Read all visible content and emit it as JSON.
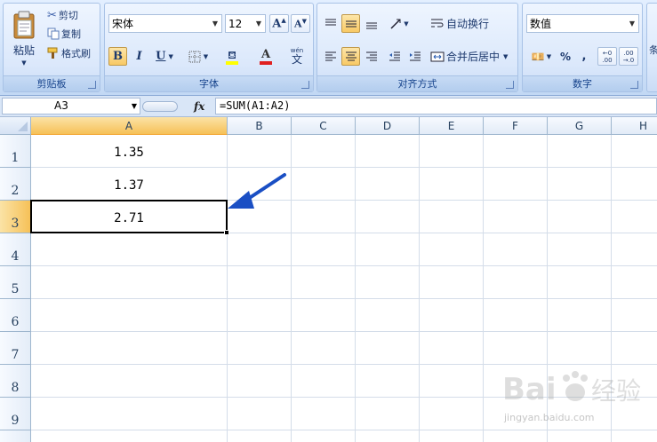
{
  "ribbon": {
    "clipboard": {
      "title": "剪贴板",
      "paste": "粘贴",
      "cut": "剪切",
      "copy": "复制",
      "format_painter": "格式刷"
    },
    "font": {
      "title": "字体",
      "font_name": "宋体",
      "font_size": "12",
      "bold": "B",
      "italic": "I",
      "underline": "U",
      "font_color_glyph": "A",
      "phonetic_top": "wén",
      "phonetic_bottom": "文"
    },
    "alignment": {
      "title": "对齐方式",
      "wrap_text": "自动换行",
      "merge_center": "合并后居中"
    },
    "number": {
      "title": "数值",
      "format": "数值",
      "percent": "%",
      "comma": ",",
      "inc_decimal_top": "←0",
      "inc_decimal_bottom": ".00",
      "dec_decimal_top": ".00",
      "dec_decimal_bottom": "→.0",
      "group_title": "数字"
    },
    "partial_label": "条"
  },
  "formula_bar": {
    "name_box": "A3",
    "fx": "fx",
    "formula": "=SUM(A1:A2)"
  },
  "sheet": {
    "columns": [
      "A",
      "B",
      "C",
      "D",
      "E",
      "F",
      "G",
      "H"
    ],
    "rows": [
      "1",
      "2",
      "3",
      "4",
      "5",
      "6",
      "7",
      "8",
      "9"
    ],
    "cells": {
      "A1": "1.35",
      "A2": "1.37",
      "A3": "2.71"
    },
    "active_cell": "A3"
  },
  "colors": {
    "ribbon_bg": "#d1e3fa",
    "active_header": "#f6c158",
    "arrow": "#1a4fc4",
    "font_color_bar": "#e02020",
    "highlight_bar": "#ffff00"
  },
  "watermark": {
    "brand": "Bai 经验",
    "url": "jingyan.baidu.com"
  }
}
